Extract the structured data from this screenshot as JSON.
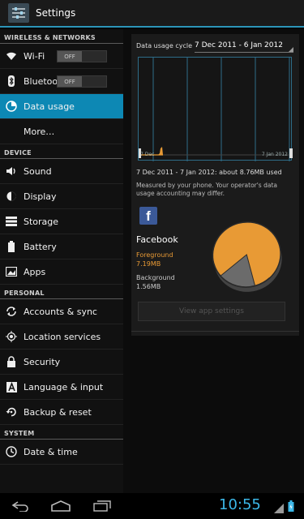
{
  "header": {
    "title": "Settings",
    "icon": "settings-app-icon"
  },
  "sidebar": {
    "sections": [
      {
        "label": "WIRELESS & NETWORKS"
      },
      {
        "label": "DEVICE"
      },
      {
        "label": "PERSONAL"
      },
      {
        "label": "SYSTEM"
      }
    ],
    "items": {
      "wifi": {
        "label": "Wi-Fi",
        "toggle": "OFF",
        "icon": "wifi-icon"
      },
      "bluetooth": {
        "label": "Bluetooth",
        "toggle": "OFF",
        "icon": "bluetooth-icon"
      },
      "data_usage": {
        "label": "Data usage",
        "icon": "data-usage-icon"
      },
      "more": {
        "label": "More…"
      },
      "sound": {
        "label": "Sound",
        "icon": "speaker-icon"
      },
      "display": {
        "label": "Display",
        "icon": "brightness-icon"
      },
      "storage": {
        "label": "Storage",
        "icon": "storage-icon"
      },
      "battery": {
        "label": "Battery",
        "icon": "battery-icon"
      },
      "apps": {
        "label": "Apps",
        "icon": "apps-icon"
      },
      "accounts": {
        "label": "Accounts & sync",
        "icon": "sync-icon"
      },
      "location": {
        "label": "Location services",
        "icon": "location-icon"
      },
      "security": {
        "label": "Security",
        "icon": "lock-icon"
      },
      "language": {
        "label": "Language & input",
        "icon": "keyboard-icon"
      },
      "backup": {
        "label": "Backup & reset",
        "icon": "restore-icon"
      },
      "datetime": {
        "label": "Date & time",
        "icon": "clock-icon"
      }
    }
  },
  "detail": {
    "cycle_label": "Data usage cycle",
    "cycle_value": "7 Dec 2011 - 6 Jan 2012",
    "chart_start_label": "7 Dec",
    "chart_end_label": "7 Jan 2012",
    "summary": "7 Dec 2011 - 7 Jan 2012: about 8.76MB used",
    "measured_note": "Measured by your phone. Your operator's data usage accounting may differ.",
    "app": {
      "name": "Facebook",
      "foreground_label": "Foreground",
      "foreground_value": "7.19MB",
      "background_label": "Background",
      "background_value": "1.56MB",
      "foreground_share": 0.82,
      "background_share": 0.18
    },
    "button": "View app settings"
  },
  "status": {
    "time": "10:55"
  },
  "colors": {
    "accent": "#0d88b4",
    "foreground": "#e89a35",
    "background_slice": "#6b6b6b",
    "clock": "#3cb8e8"
  }
}
